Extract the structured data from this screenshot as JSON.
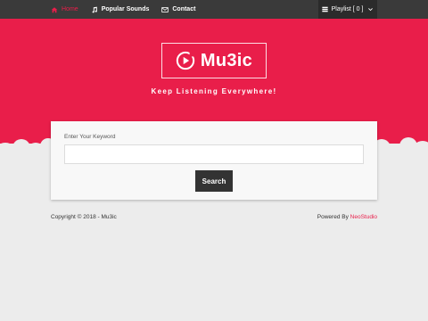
{
  "nav": {
    "items": [
      {
        "label": "Home",
        "icon": "home-icon",
        "active": true
      },
      {
        "label": "Popular Sounds",
        "icon": "music-note-icon",
        "active": false
      },
      {
        "label": "Contact",
        "icon": "envelope-icon",
        "active": false
      }
    ],
    "playlist_label": "Playlist [ 0 ]"
  },
  "hero": {
    "logo_text": "Mu3ic",
    "tagline": "Keep Listening Everywhere!"
  },
  "search": {
    "label": "Enter Your Keyword",
    "value": "",
    "placeholder": "",
    "button_label": "Search"
  },
  "footer": {
    "copyright": "Copyright © 2018 - Mu3ic",
    "powered_prefix": "Powered By ",
    "powered_brand": "NeoStudio"
  },
  "colors": {
    "accent": "#e91e4a",
    "topbar": "#3a3a3a",
    "button": "#333333",
    "background": "#ececec"
  }
}
